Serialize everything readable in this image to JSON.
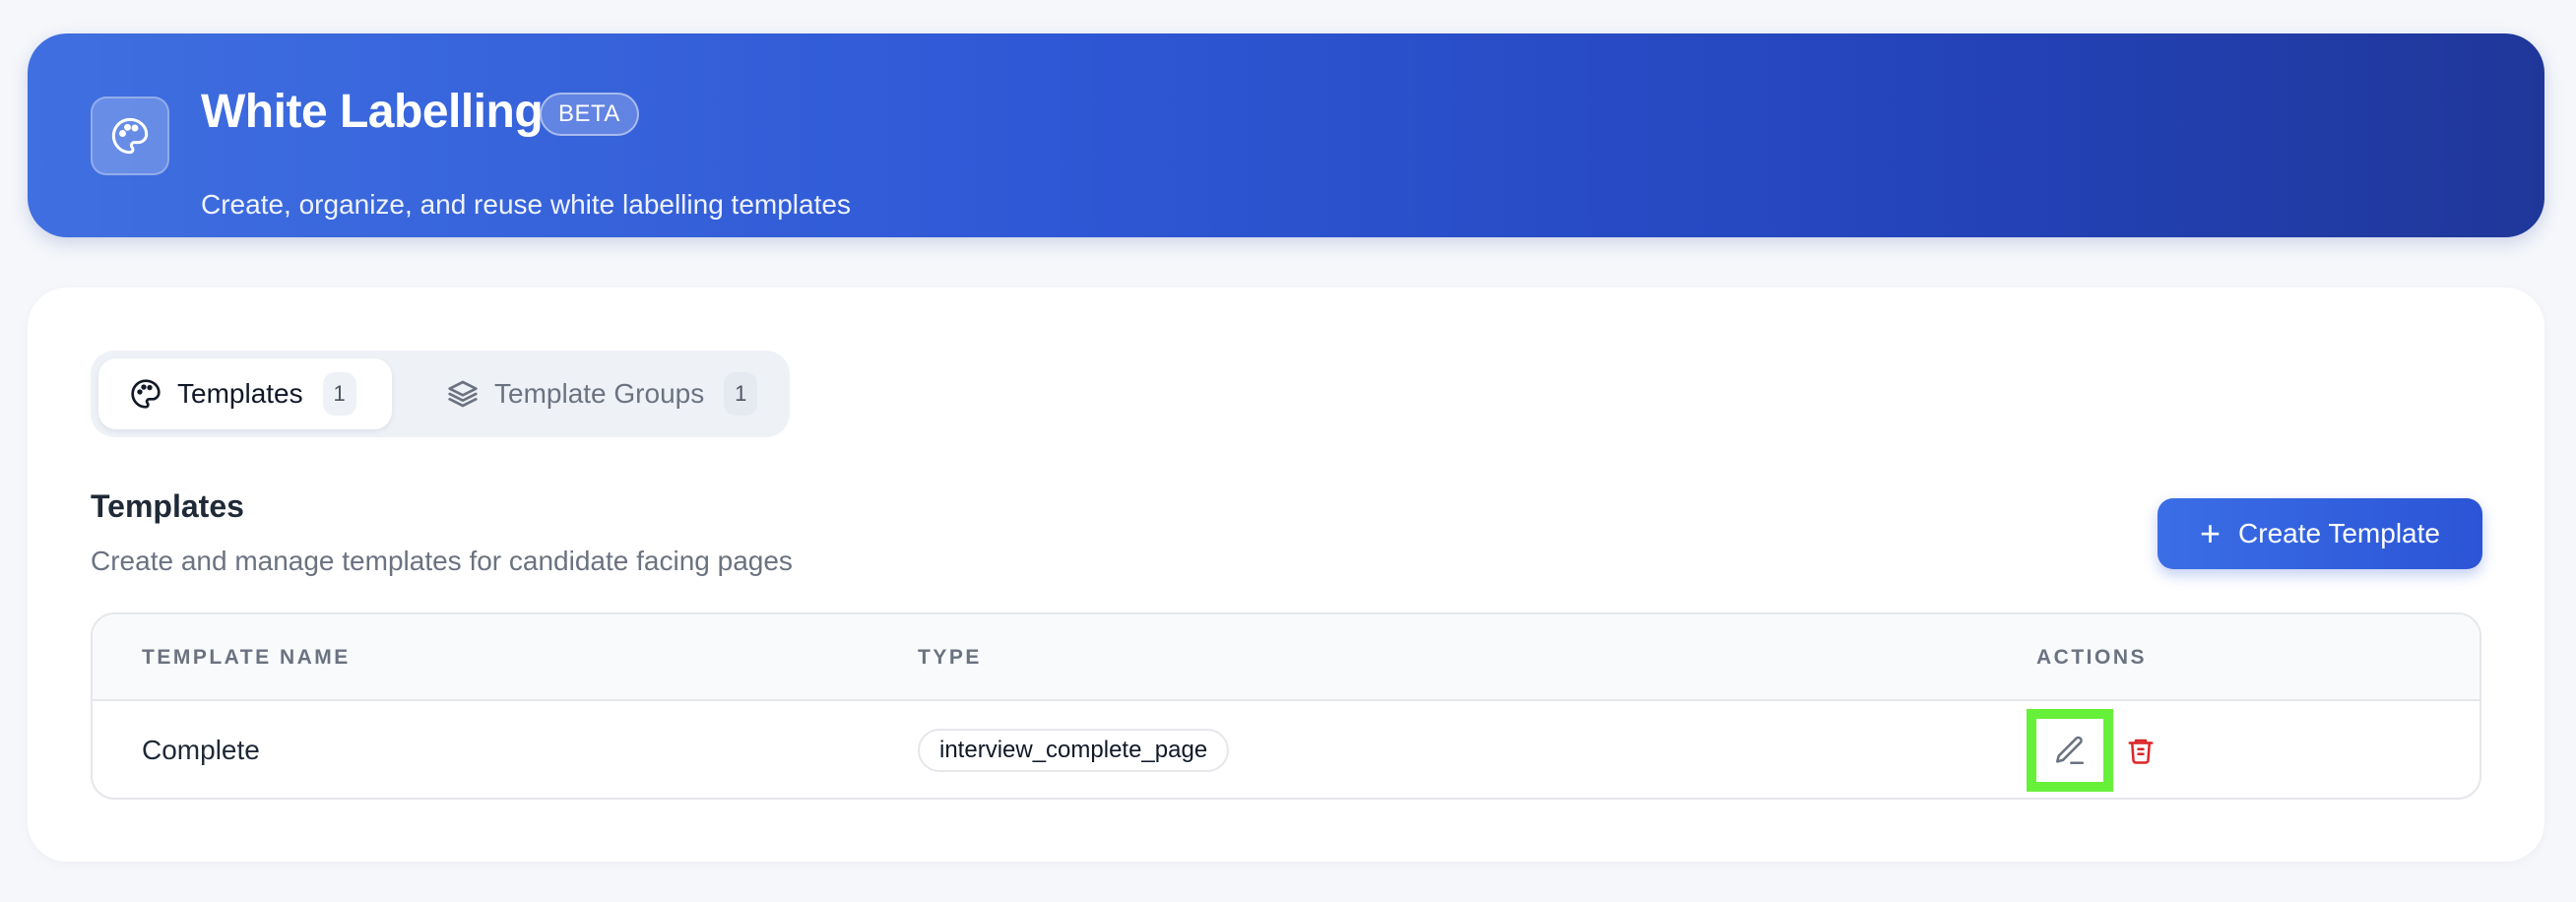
{
  "header": {
    "title": "White Labelling",
    "badge": "BETA",
    "subtitle": "Create, organize, and reuse white labelling templates",
    "icon": "palette-icon"
  },
  "tabs": [
    {
      "label": "Templates",
      "count": "1",
      "icon": "palette-icon",
      "active": true
    },
    {
      "label": "Template Groups",
      "count": "1",
      "icon": "layers-icon",
      "active": false
    }
  ],
  "section": {
    "title": "Templates",
    "subtitle": "Create and manage templates for candidate facing pages",
    "create_button": "Create Template"
  },
  "table": {
    "columns": [
      "TEMPLATE NAME",
      "TYPE",
      "ACTIONS"
    ],
    "rows": [
      {
        "name": "Complete",
        "type": "interview_complete_page",
        "actions": [
          "edit-icon",
          "trash-icon"
        ]
      }
    ]
  },
  "colors": {
    "brand": "#2f58d6",
    "highlight": "#67f03a",
    "danger": "#dc2626"
  }
}
